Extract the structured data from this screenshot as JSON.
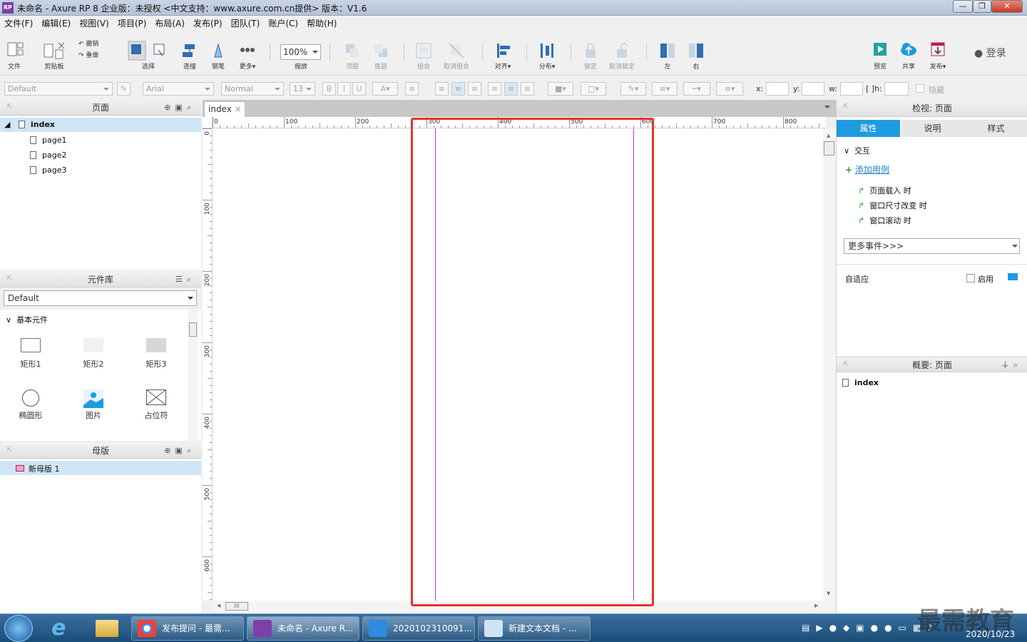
{
  "window": {
    "title": "未命名 - Axure RP 8 企业版：未授权     <中文支持：www.axure.com.cn提供> 版本：V1.6",
    "logo": "RP",
    "controls": [
      "minimize-icon",
      "maximize-icon",
      "close-icon"
    ]
  },
  "menu": [
    "文件(F)",
    "编辑(E)",
    "视图(V)",
    "项目(P)",
    "布局(A)",
    "发布(P)",
    "团队(T)",
    "账户(C)",
    "帮助(H)"
  ],
  "toolbar": {
    "file": "文件",
    "clipboard": "剪贴板",
    "undo": "撤销",
    "redo": "重做",
    "select": "选择",
    "connect": "连接",
    "pen": "钢笔",
    "more": "更多▾",
    "zoom_value": "100%",
    "zoom": "缩放",
    "top": "顶层",
    "bottom": "底层",
    "group": "组合",
    "ungroup": "取消组合",
    "align": "对齐▾",
    "distribute": "分布▾",
    "lock": "锁定",
    "unlock": "取消锁定",
    "left": "左",
    "right": "右",
    "preview": "预览",
    "share": "共享",
    "publish": "发布▾",
    "login": "登录"
  },
  "format": {
    "style": "Default",
    "font": "Arial",
    "weight": "Normal",
    "size": "13",
    "x_label": "x:",
    "y_label": "y:",
    "w_label": "w:",
    "h_label": "h:",
    "hidden": "隐藏"
  },
  "pages_panel": {
    "title": "页面",
    "pages": [
      "index",
      "page1",
      "page2",
      "page3"
    ]
  },
  "library_panel": {
    "title": "元件库",
    "selected": "Default",
    "section": "基本元件",
    "widgets": [
      "矩形1",
      "矩形2",
      "矩形3",
      "椭圆形",
      "图片",
      "占位符"
    ]
  },
  "masters_panel": {
    "title": "母版",
    "items": [
      "新母版 1"
    ]
  },
  "canvas": {
    "tab": "index",
    "h_ruler": [
      "0",
      "100",
      "200",
      "300",
      "400",
      "500",
      "600",
      "700",
      "800"
    ],
    "v_ruler": [
      "0",
      "100",
      "200",
      "300",
      "400",
      "500",
      "600"
    ],
    "guide_color": "#b23fd0",
    "highlight_color": "#e8322b"
  },
  "inspector": {
    "title": "检视: 页面",
    "tabs": [
      "属性",
      "说明",
      "样式"
    ],
    "section": "交互",
    "add_case": "添加用例",
    "events": [
      "页面载入 时",
      "窗口尺寸改变 时",
      "窗口滚动 时"
    ],
    "more_events": "更多事件>>>",
    "adaptive": "自适应",
    "enable": "启用",
    "accent": "#1e9be0"
  },
  "outline": {
    "title": "概要: 页面",
    "items": [
      "index"
    ]
  },
  "taskbar": {
    "tasks": [
      "发布提问 - 最需...",
      "未命名 - Axure R...",
      "2020102310091...",
      "新建文本文档 - ..."
    ],
    "date": "2020/10/23",
    "watermark": "最需教育"
  }
}
